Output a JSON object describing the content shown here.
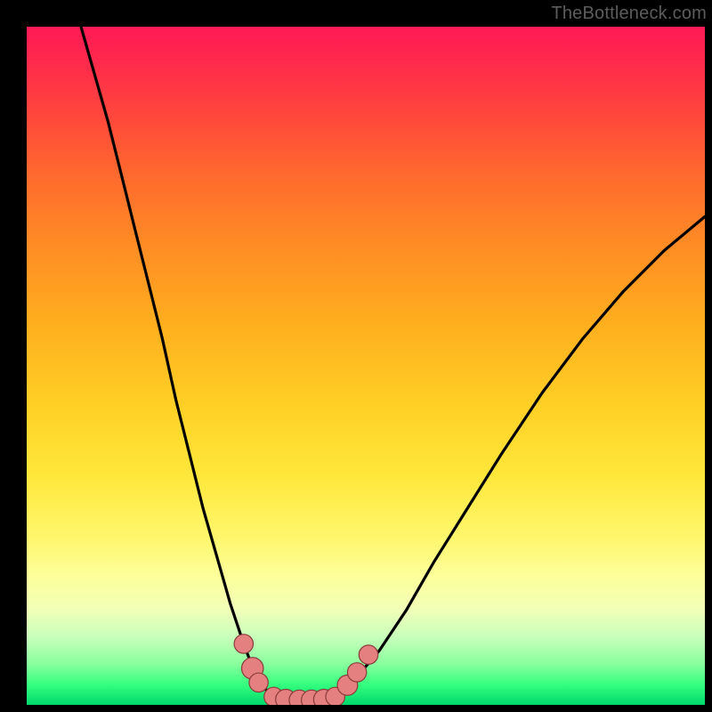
{
  "watermark": "TheBottleneck.com",
  "colors": {
    "background": "#000000",
    "gradient_top": "#ff1a56",
    "gradient_mid": "#ffd026",
    "gradient_bottom": "#00d96c",
    "curve_stroke": "#000000",
    "marker_fill": "#e48080",
    "marker_stroke": "#8a3a3a"
  },
  "chart_data": {
    "type": "line",
    "title": "",
    "xlabel": "",
    "ylabel": "",
    "xlim": [
      0,
      100
    ],
    "ylim": [
      0,
      100
    ],
    "grid": false,
    "legend": false,
    "note": "Values approximate; read by pixel position relative to 762×762 plot area. y=0 at bottom, x=0 at left.",
    "series": [
      {
        "name": "left-branch",
        "x": [
          8,
          10,
          12,
          14,
          16,
          18,
          20,
          22,
          24,
          26,
          28,
          30,
          32,
          33.5,
          35,
          36.5
        ],
        "y": [
          100,
          93,
          86,
          78,
          70,
          62,
          54,
          45,
          37,
          29,
          22,
          15,
          9,
          5,
          2.5,
          1.2
        ]
      },
      {
        "name": "valley-floor",
        "x": [
          36.5,
          38,
          40,
          42,
          44,
          45.5
        ],
        "y": [
          1.2,
          0.8,
          0.7,
          0.7,
          0.8,
          1.2
        ]
      },
      {
        "name": "right-branch",
        "x": [
          45.5,
          47,
          49,
          52,
          56,
          60,
          65,
          70,
          76,
          82,
          88,
          94,
          100
        ],
        "y": [
          1.2,
          2.4,
          4.5,
          8,
          14,
          21,
          29,
          37,
          46,
          54,
          61,
          67,
          72
        ]
      }
    ],
    "markers": [
      {
        "x": 32.0,
        "y": 9.0,
        "r": 1.4
      },
      {
        "x": 33.3,
        "y": 5.4,
        "r": 1.6
      },
      {
        "x": 34.2,
        "y": 3.3,
        "r": 1.4
      },
      {
        "x": 36.4,
        "y": 1.2,
        "r": 1.4
      },
      {
        "x": 38.2,
        "y": 0.8,
        "r": 1.5
      },
      {
        "x": 40.2,
        "y": 0.7,
        "r": 1.5
      },
      {
        "x": 42.0,
        "y": 0.7,
        "r": 1.5
      },
      {
        "x": 43.8,
        "y": 0.8,
        "r": 1.5
      },
      {
        "x": 45.5,
        "y": 1.2,
        "r": 1.4
      },
      {
        "x": 47.3,
        "y": 2.9,
        "r": 1.5
      },
      {
        "x": 48.7,
        "y": 4.8,
        "r": 1.4
      },
      {
        "x": 50.4,
        "y": 7.4,
        "r": 1.4
      }
    ]
  }
}
